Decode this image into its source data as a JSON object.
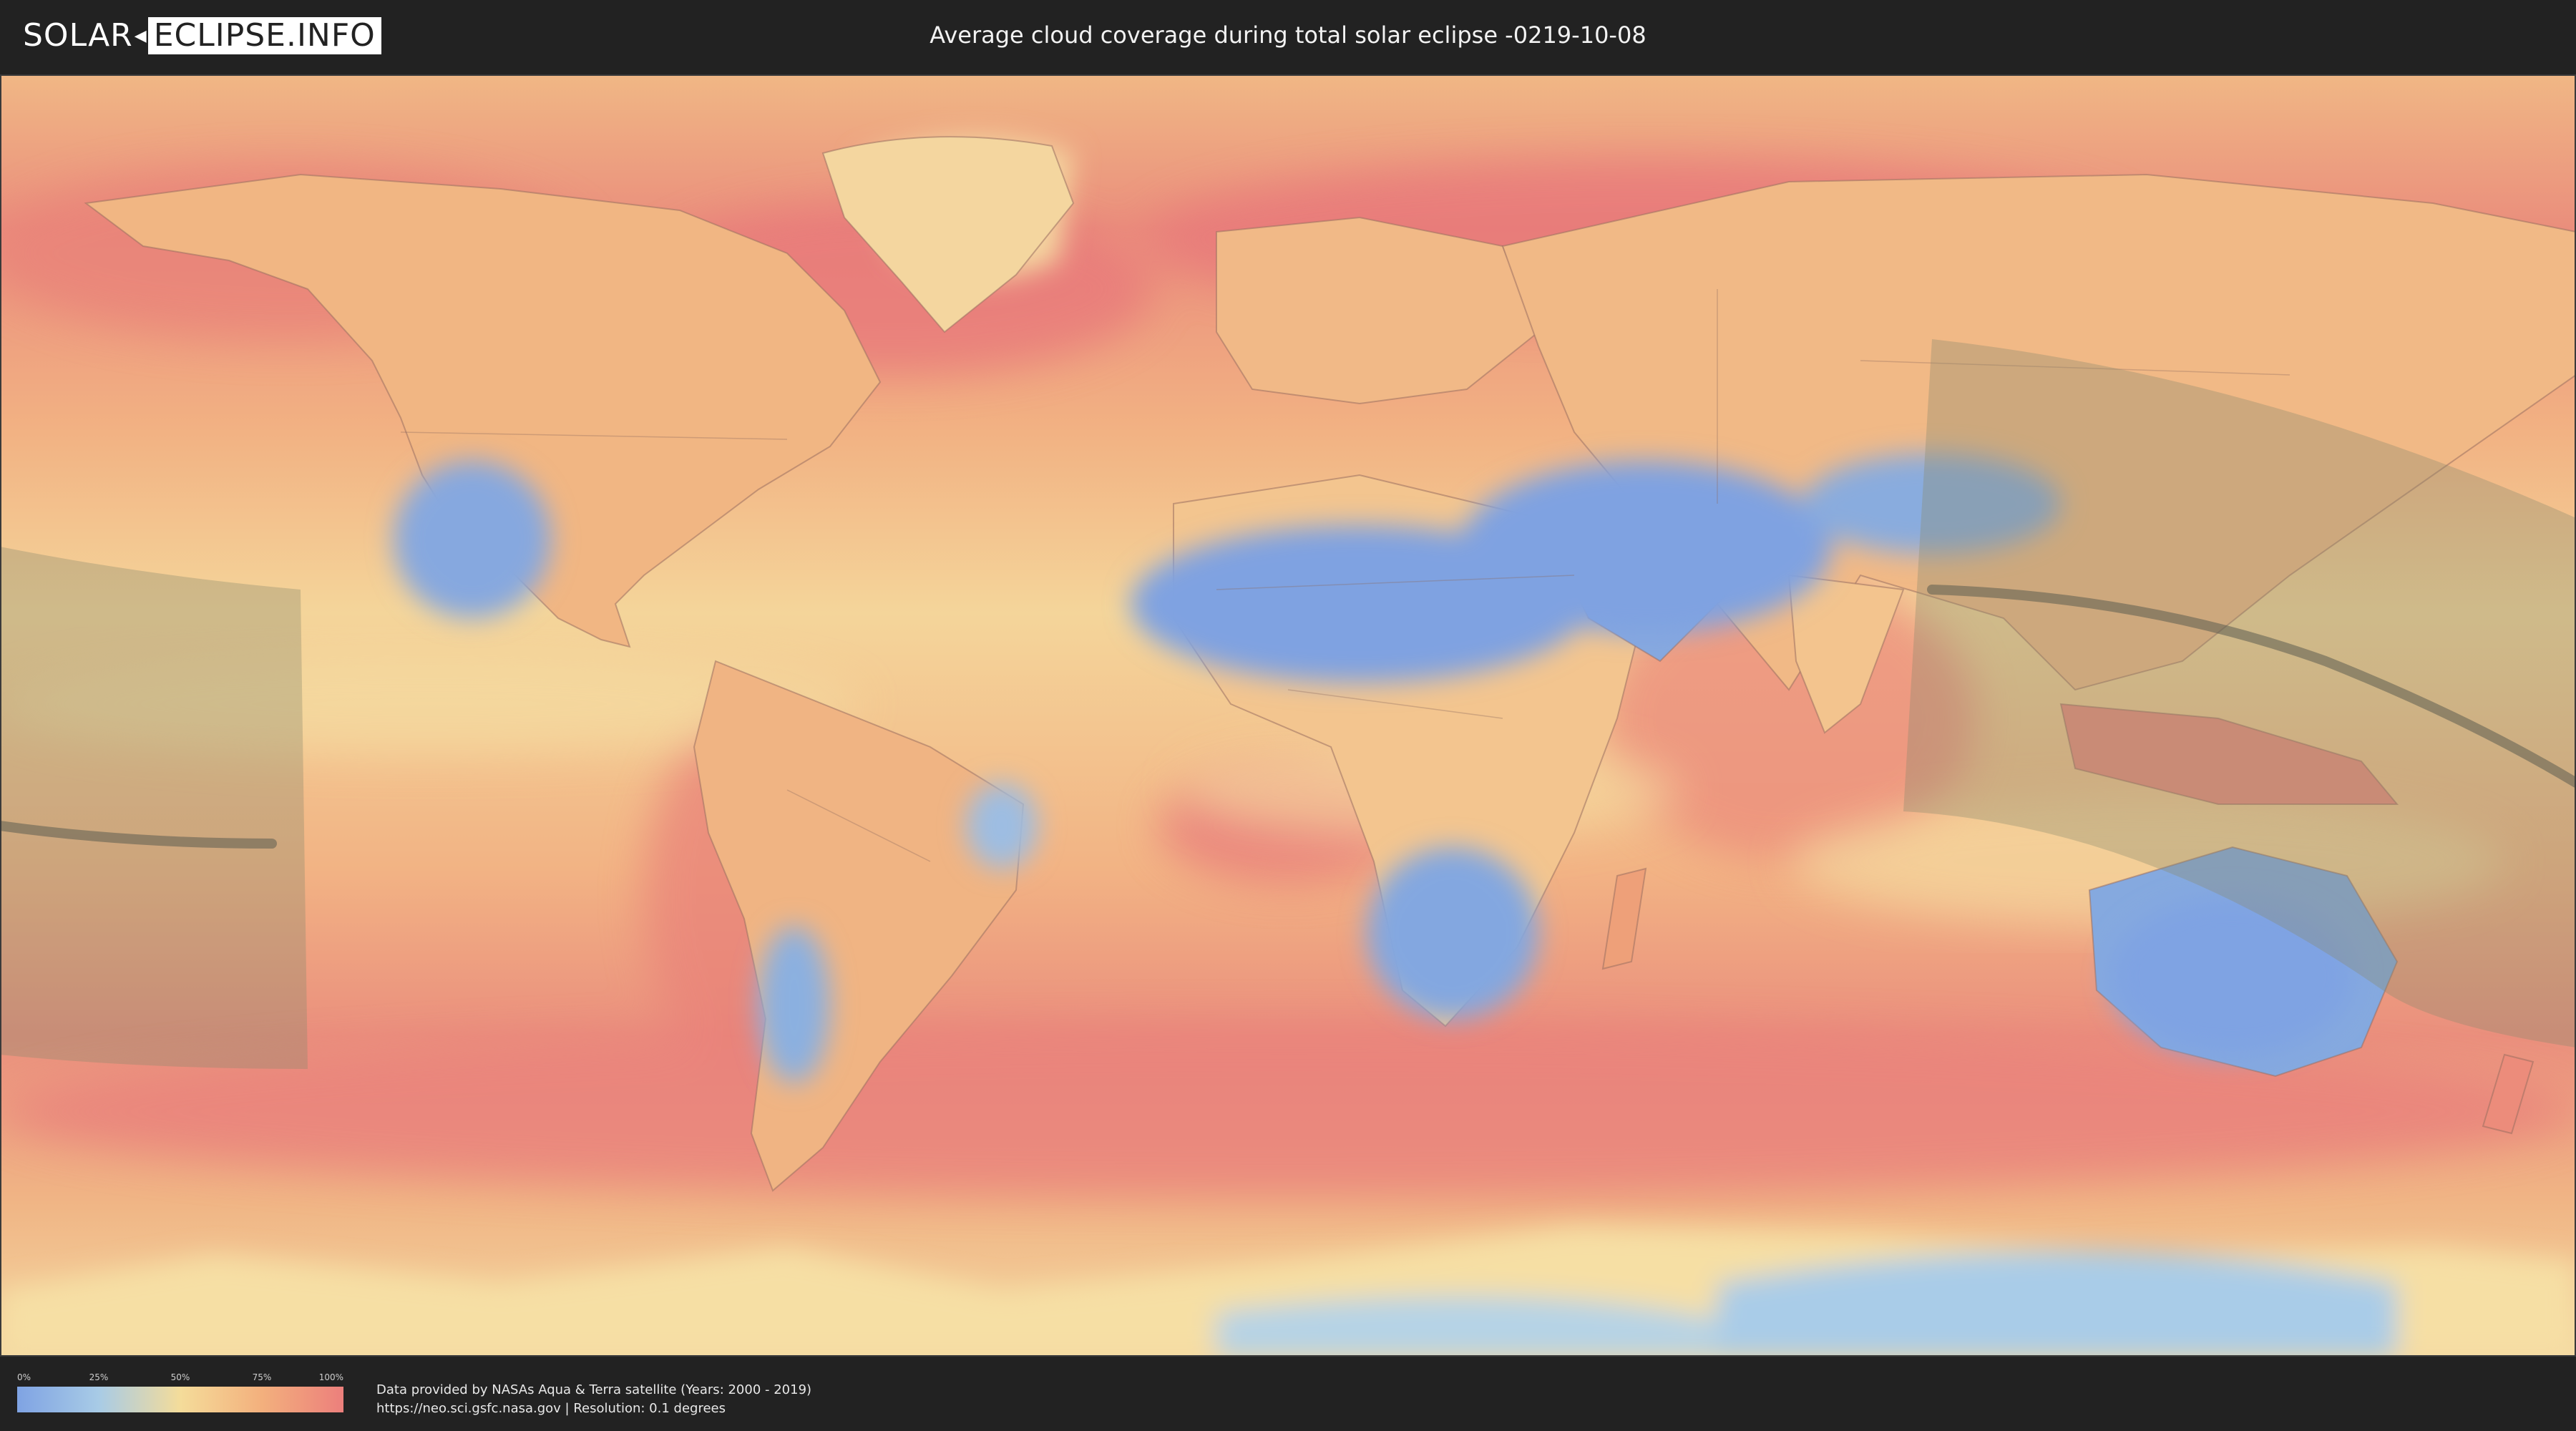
{
  "header": {
    "logo_left": "SOLAR",
    "logo_right": "ECLIPSE.INFO",
    "title": "Average cloud coverage during total solar eclipse -0219-10-08"
  },
  "colors": {
    "background": "#222222",
    "clear_sky": "#7fa3e3",
    "low_cloud": "#a8cbe6",
    "mid_cloud": "#f4dc9a",
    "high_cloud": "#f3b07d",
    "full_cloud": "#ec7f7c",
    "eclipse_band": "#8a8a6e",
    "eclipse_path": "#5c5c50"
  },
  "legend": {
    "ticks": [
      "0%",
      "25%",
      "50%",
      "75%",
      "100%"
    ],
    "tick_values": [
      0,
      25,
      50,
      75,
      100
    ]
  },
  "credits": {
    "line1": "Data provided by NASAs Aqua & Terra satellite (Years: 2000 - 2019)",
    "line2": "https://neo.sci.gsfc.nasa.gov | Resolution: 0.1 degrees"
  },
  "map": {
    "projection": "equirectangular",
    "layer": "cloud-coverage",
    "overlay": "total-eclipse-path"
  }
}
